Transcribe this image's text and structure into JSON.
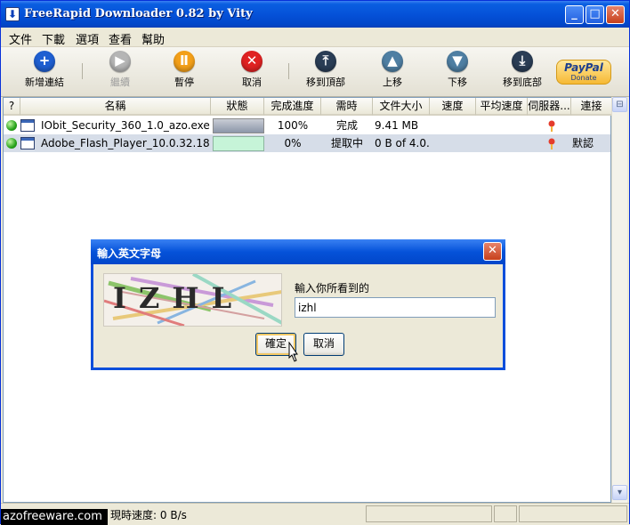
{
  "window": {
    "title": "FreeRapid Downloader 0.82 by Vity",
    "min_label": "_",
    "max_label": "□",
    "close_label": "✕"
  },
  "menu": [
    "文件",
    "下載",
    "選項",
    "查看",
    "幫助"
  ],
  "toolbar": {
    "add": "新增連結",
    "resume": "繼續",
    "pause": "暫停",
    "cancel": "取消",
    "top": "移到頂部",
    "up": "上移",
    "down": "下移",
    "bottom": "移到底部",
    "paypal_logo": "PayPal",
    "paypal_donate": "Donate"
  },
  "table": {
    "columns": [
      "?",
      "名稱",
      "狀態",
      "完成進度",
      "需時",
      "文件大小",
      "速度",
      "平均速度",
      "伺服器...",
      "連接"
    ],
    "rows": [
      {
        "name": "IObit_Security_360_1.0_azo.exe",
        "progress": "100%",
        "progress_fraction": 1.0,
        "time": "完成",
        "size": "9.41 MB",
        "speed": "",
        "avg_speed": "",
        "connection": ""
      },
      {
        "name": "Adobe_Flash_Player_10.0.32.18...",
        "progress": "0%",
        "progress_fraction": 0.0,
        "time": "提取中",
        "size": "0 B of 4.0...",
        "speed": "",
        "avg_speed": "",
        "connection": "默認"
      }
    ]
  },
  "status": {
    "text": "已完成1 中的2下載 - 現時速度: 0 B/s"
  },
  "watermark": "azofreeware.com",
  "dialog": {
    "title": "輸入英文字母",
    "captcha_text": "IZHL",
    "prompt": "輸入你所看到的",
    "input_value": "izhl",
    "ok": "確定",
    "cancel": "取消"
  }
}
